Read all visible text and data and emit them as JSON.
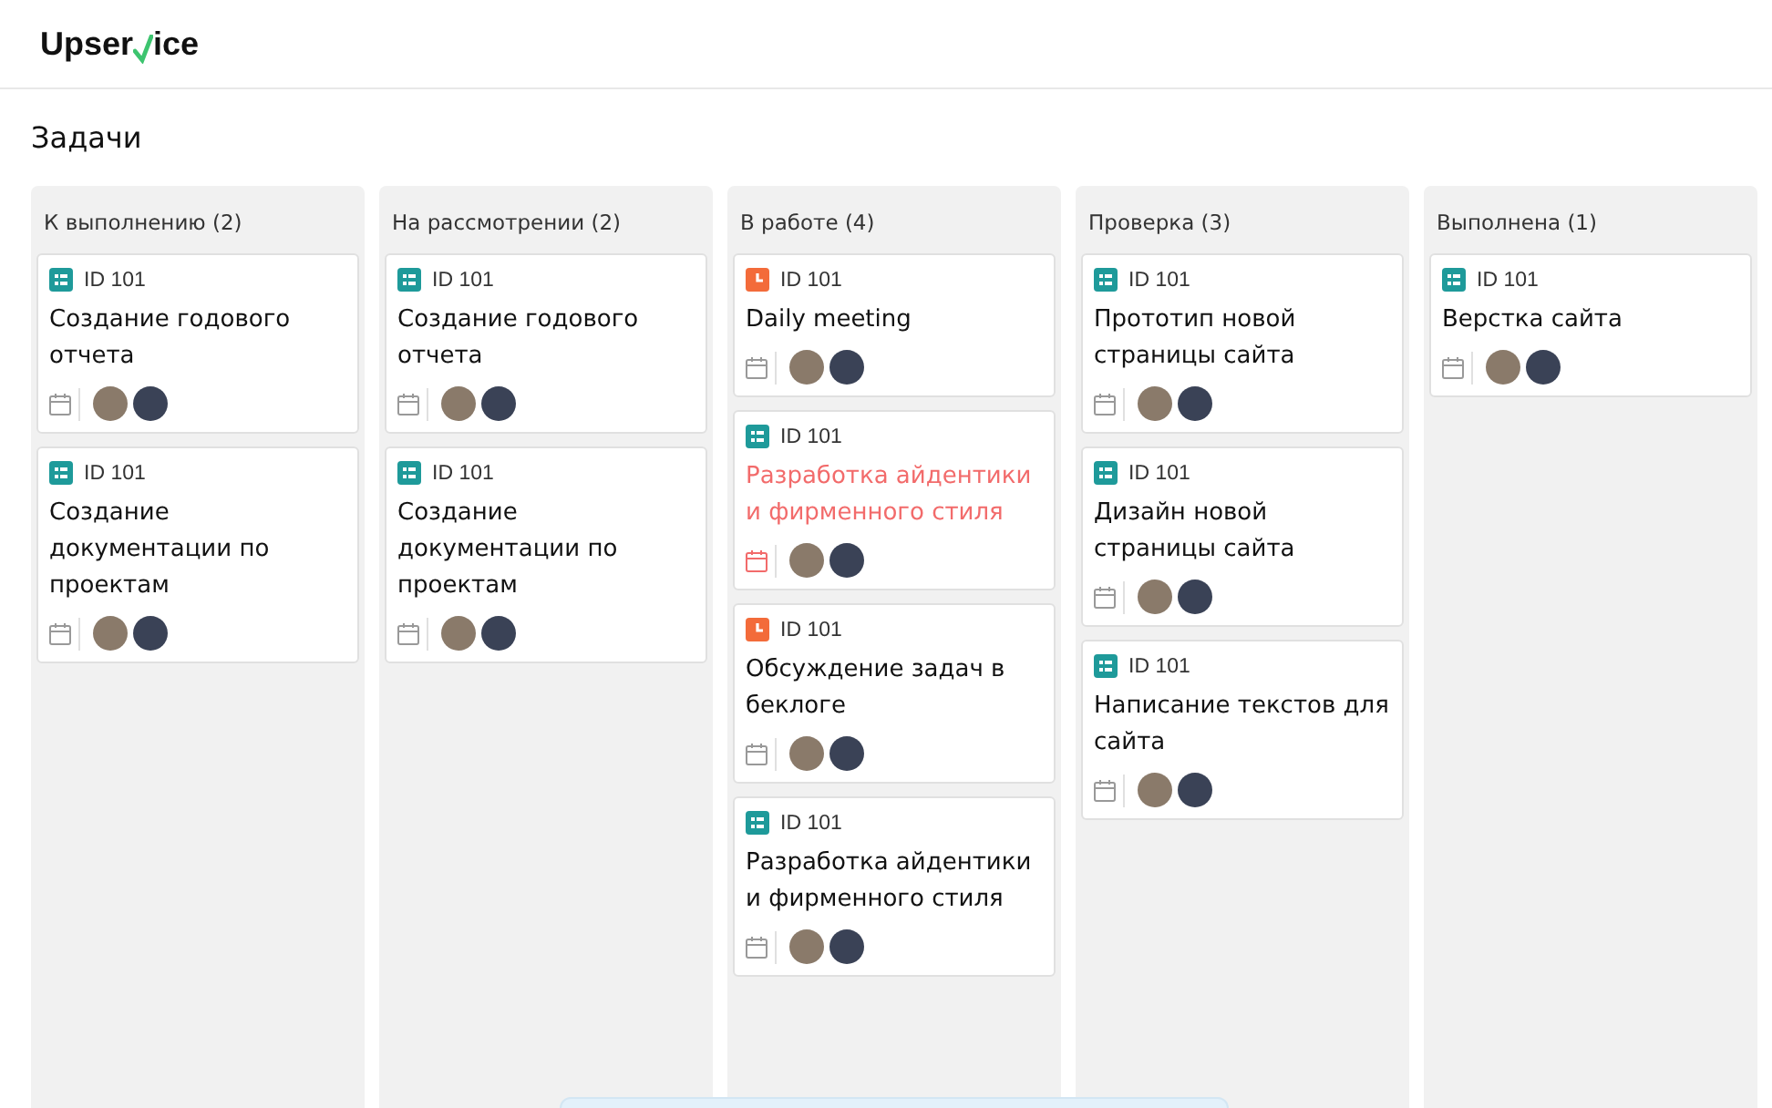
{
  "logo": {
    "before": "Upser",
    "after": "ice"
  },
  "page_title": "Задачи",
  "columns": [
    {
      "title": "К выполнению (2)",
      "cards": [
        {
          "kind": "task",
          "id": "ID 101",
          "title": "Создание годового отчета",
          "overdue": false
        },
        {
          "kind": "task",
          "id": "ID 101",
          "title": "Создание документации по проектам",
          "overdue": false
        }
      ]
    },
    {
      "title": "На рассмотрении (2)",
      "cards": [
        {
          "kind": "task",
          "id": "ID 101",
          "title": "Создание годового отчета",
          "overdue": false
        },
        {
          "kind": "task",
          "id": "ID 101",
          "title": "Создание документации по проектам",
          "overdue": false
        }
      ]
    },
    {
      "title": "В работе (4)",
      "cards": [
        {
          "kind": "meeting",
          "id": "ID 101",
          "title": "Daily meeting",
          "overdue": false
        },
        {
          "kind": "task",
          "id": "ID 101",
          "title": "Разработка айдентики и фирменного стиля",
          "overdue": true
        },
        {
          "kind": "meeting",
          "id": "ID 101",
          "title": "Обсуждение задач в беклоге",
          "overdue": false
        },
        {
          "kind": "task",
          "id": "ID 101",
          "title": "Разработка айдентики и фирменного стиля",
          "overdue": false
        }
      ]
    },
    {
      "title": "Проверка (3)",
      "cards": [
        {
          "kind": "task",
          "id": "ID 101",
          "title": "Прототип новой страницы сайта",
          "overdue": false
        },
        {
          "kind": "task",
          "id": "ID 101",
          "title": "Дизайн новой страницы сайта",
          "overdue": false
        },
        {
          "kind": "task",
          "id": "ID 101",
          "title": "Написание текстов для сайта",
          "overdue": false
        }
      ]
    },
    {
      "title": "Выполнена (1)",
      "cards": [
        {
          "kind": "task",
          "id": "ID 101",
          "title": "Верстка сайта",
          "overdue": false
        }
      ]
    }
  ]
}
